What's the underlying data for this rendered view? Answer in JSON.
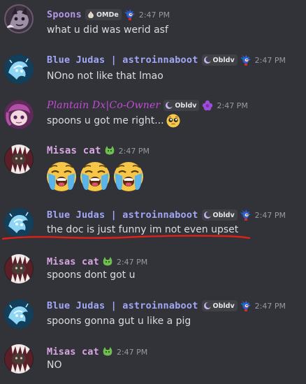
{
  "colors": {
    "background": "#313338",
    "text": "#dbdee1",
    "timestamp": "#949ba4",
    "spoons_name": "#b397e8",
    "blue_judas_name": "#a3a7f5",
    "plantain_name": "#c54bd9",
    "misas_name": "#d9a6e3",
    "red_mark": "#e0201a"
  },
  "messages": [
    {
      "author": "Spoons",
      "tag_icon": "garlic-icon",
      "tag": "OMDe",
      "role_icon": "sonic-icon",
      "time": "2:47 PM",
      "text": "what u did was werid asf"
    },
    {
      "author": "Blue Judas | astroinnaboot",
      "tag_icon": "moon-icon",
      "tag": "Obldv",
      "role_icon": "sonic-icon",
      "time": "2:47 PM",
      "text": "NOno not like that lmao"
    },
    {
      "author": "Plantain Dx|Co-Owner",
      "tag_icon": "moon-icon",
      "tag": "Obldv",
      "role_icon": "purple-flower-icon",
      "time": "2:47 PM",
      "text": "spoons u got me right...",
      "emoji": "pleading-face-emoji"
    },
    {
      "author": "Misas cat",
      "role_icon": "cat-icon",
      "time": "2:47 PM",
      "emojis": [
        "loudly-crying-face-emoji",
        "loudly-crying-face-emoji",
        "loudly-crying-face-emoji"
      ]
    },
    {
      "author": "Blue Judas | astroinnaboot",
      "tag_icon": "moon-icon",
      "tag": "Obldv",
      "role_icon": "sonic-icon",
      "time": "2:47 PM",
      "text": "the doc is just funny im not even upset"
    },
    {
      "author": "Misas cat",
      "role_icon": "cat-icon",
      "time": "2:47 PM",
      "text": "spoons dont got u"
    },
    {
      "author": "Blue Judas | astroinnaboot",
      "tag_icon": "moon-icon",
      "tag": "Obldv",
      "role_icon": "sonic-icon",
      "time": "2:47 PM",
      "text": "spoons gonna gut u like a pig"
    },
    {
      "author": "Misas cat",
      "role_icon": "cat-icon",
      "time": "2:47 PM",
      "text": "NO"
    }
  ]
}
